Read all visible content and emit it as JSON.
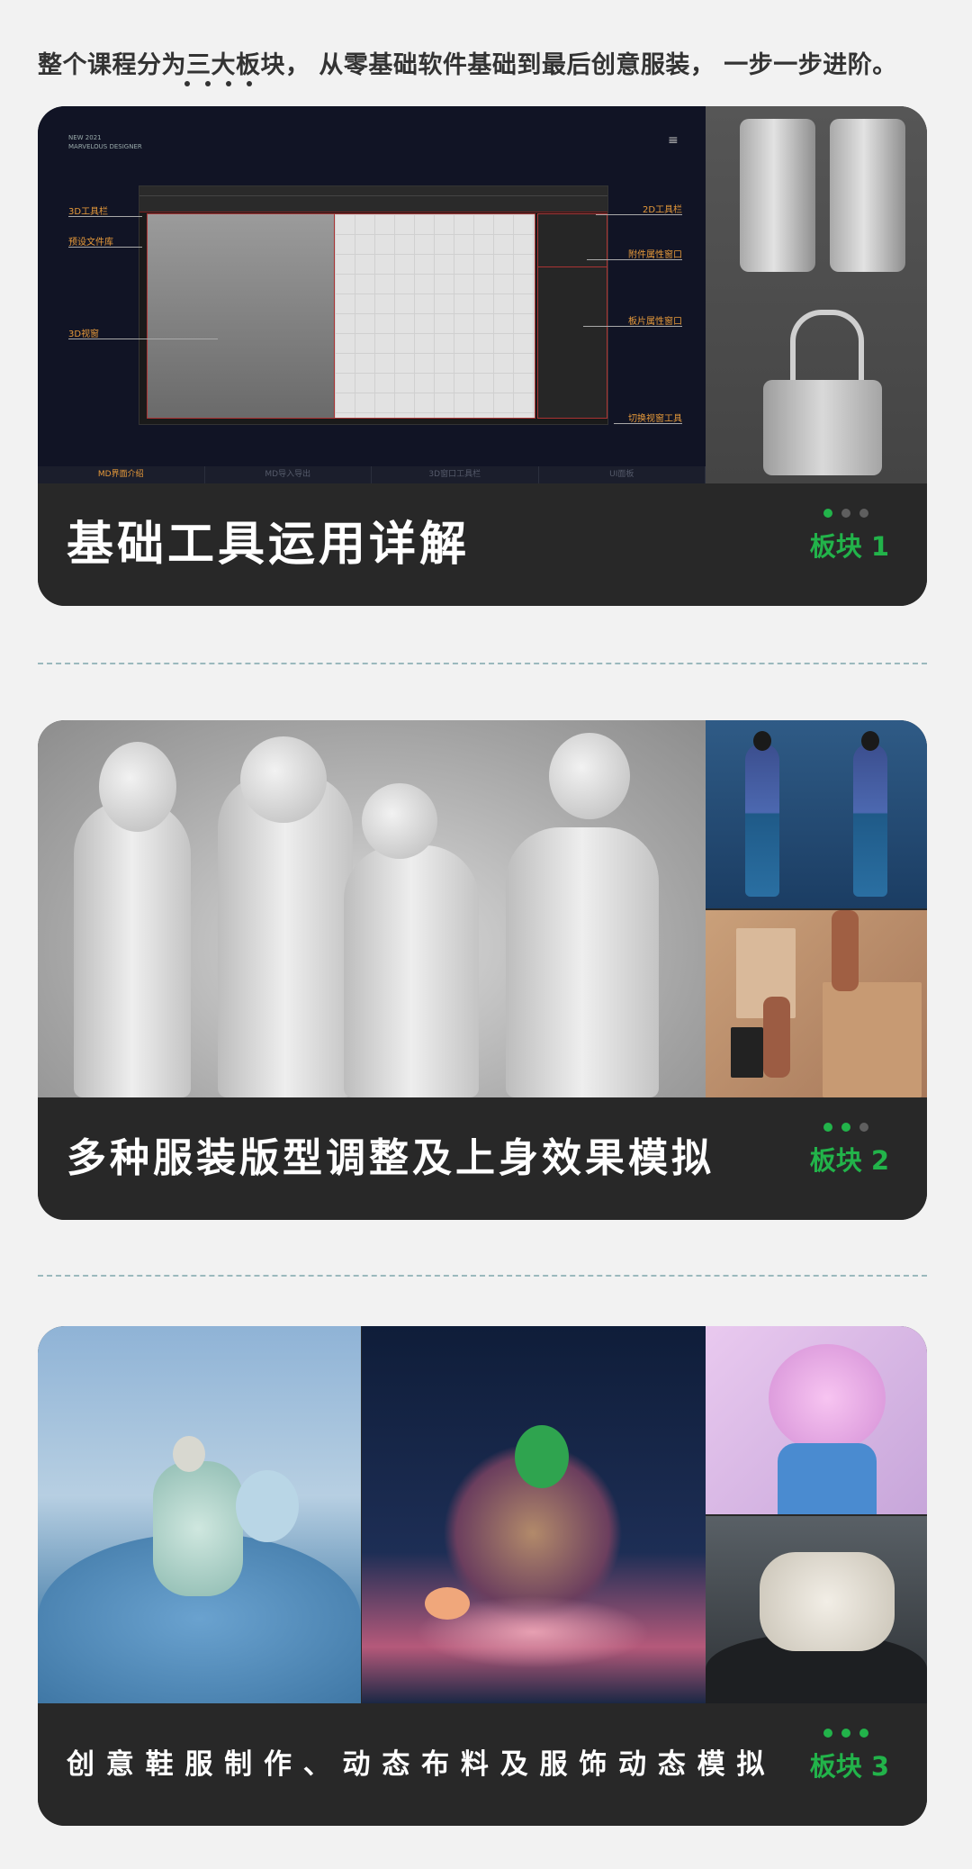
{
  "intro": "整个课程分为三大板块， 从零基础软件基础到最后创意服装， 一步一步进阶。",
  "sections": [
    {
      "title": "基础工具运用详解",
      "badge": "板块 1",
      "software": {
        "brand_line1": "NEW 2021",
        "brand_line2": "MARVELOUS DESIGNER",
        "annotations": {
          "toolbar_3d": "3D工具栏",
          "preset_library": "预设文件库",
          "viewport_3d": "3D视窗",
          "toolbar_2d": "2D工具栏",
          "accessory_props": "附件属性窗口",
          "panel_props": "板片属性窗口",
          "switch_view": "切换视窗工具"
        },
        "tabs": [
          "MD界面介绍",
          "MD导入导出",
          "3D窗口工具栏",
          "UI面板"
        ]
      }
    },
    {
      "title": "多种服装版型调整及上身效果模拟",
      "badge": "板块 2"
    },
    {
      "title": "创 意 鞋 服 制 作 、 动 态 布 料 及 服 饰 动 态 模 拟",
      "badge": "板块 3"
    }
  ],
  "colors": {
    "accent_green": "#22b34a",
    "card_bg": "#282828",
    "page_bg": "#f2f2f2",
    "annotation_orange": "#e79a3a"
  }
}
